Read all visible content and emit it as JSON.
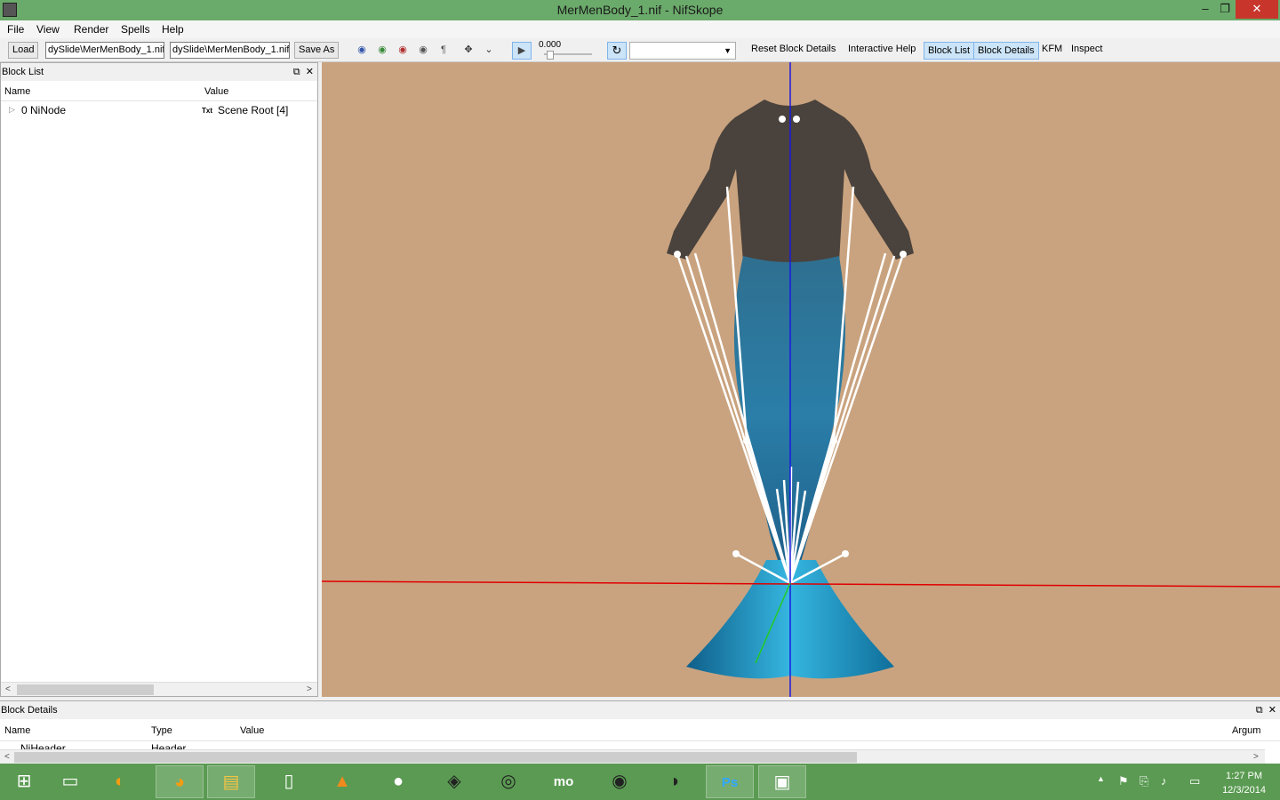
{
  "window": {
    "title": "MerMenBody_1.nif - NifSkope",
    "min": "‒",
    "max": "❐",
    "close": "✕"
  },
  "menu": [
    "File",
    "View",
    "Render",
    "Spells",
    "Help"
  ],
  "toolbar": {
    "load": "Load",
    "path_in": "dySlide\\MerMenBody_1.nif",
    "path_out": "dySlide\\MerMenBody_1.nif",
    "save_as": "Save As",
    "time": "0.000",
    "reset_block_details": "Reset Block Details",
    "interactive_help": "Interactive Help",
    "block_list": "Block List",
    "block_details": "Block Details",
    "kfm": "KFM",
    "inspect": "Inspect"
  },
  "block_list": {
    "title": "Block List",
    "columns": [
      "Name",
      "Value"
    ],
    "rows": [
      {
        "name": "0 NiNode",
        "value": "Scene Root [4]",
        "type_tag": "Txt"
      }
    ]
  },
  "block_details": {
    "title": "Block Details",
    "columns": [
      "Name",
      "Type",
      "Value",
      "Argum"
    ],
    "rows": [
      {
        "name": "NiHeader",
        "type": "Header"
      }
    ]
  },
  "taskbar": {
    "clock_time": "1:27 PM",
    "clock_date": "12/3/2014",
    "apps": [
      "start",
      "explorer-window",
      "firefox-alt",
      "firefox",
      "file-explorer",
      "notepad",
      "vlc",
      "chat",
      "gamepad",
      "creation-kit",
      "mo",
      "steam",
      "skse",
      "photoshop",
      "nifskope"
    ]
  },
  "colors": {
    "viewport_bg": "#c9a37f",
    "accent": "#5a9a52"
  }
}
